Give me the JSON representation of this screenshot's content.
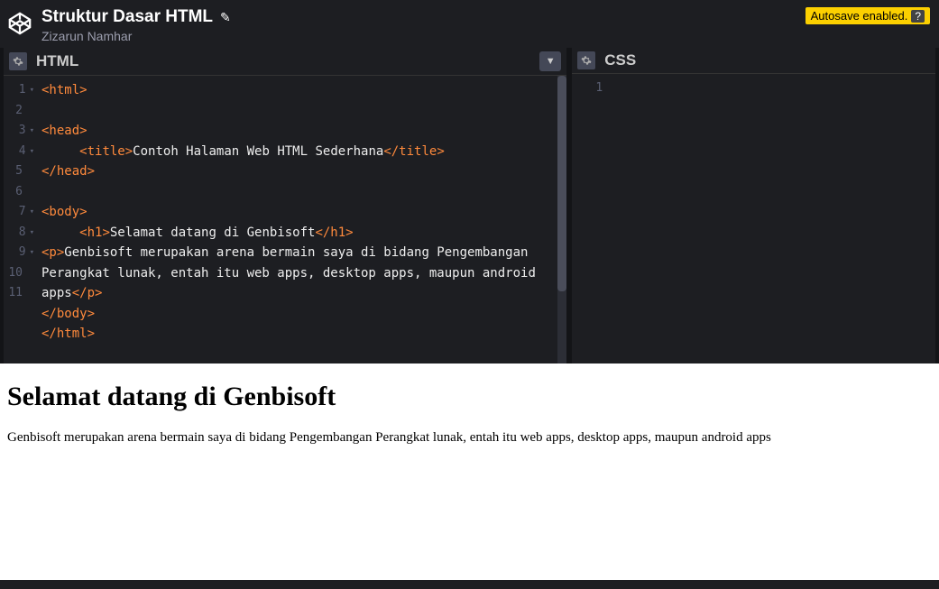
{
  "header": {
    "title": "Struktur Dasar HTML",
    "author": "Zizarun Namhar",
    "autosave": "Autosave enabled.",
    "autosave_help": "?"
  },
  "html_panel": {
    "title": "HTML",
    "lines": [
      "1",
      "2",
      "3",
      "4",
      "5",
      "6",
      "7",
      "8",
      "9",
      "",
      "10",
      "11"
    ],
    "code": [
      {
        "indent": 0,
        "tokens": [
          {
            "t": "tag",
            "v": "<html>"
          }
        ]
      },
      {
        "indent": 0,
        "tokens": []
      },
      {
        "indent": 0,
        "tokens": [
          {
            "t": "tag",
            "v": "<head>"
          }
        ]
      },
      {
        "indent": 1,
        "tokens": [
          {
            "t": "tag",
            "v": "<title>"
          },
          {
            "t": "text",
            "v": "Contoh Halaman Web HTML Sederhana"
          },
          {
            "t": "tag",
            "v": "</title>"
          }
        ]
      },
      {
        "indent": 0,
        "tokens": [
          {
            "t": "tag",
            "v": "</head>"
          }
        ]
      },
      {
        "indent": 0,
        "tokens": []
      },
      {
        "indent": 0,
        "tokens": [
          {
            "t": "tag",
            "v": "<body>"
          }
        ]
      },
      {
        "indent": 1,
        "tokens": [
          {
            "t": "tag",
            "v": "<h1>"
          },
          {
            "t": "text",
            "v": "Selamat datang di Genbisoft"
          },
          {
            "t": "tag",
            "v": "</h1>"
          }
        ]
      },
      {
        "indent": 0,
        "tokens": [
          {
            "t": "tag",
            "v": "<p>"
          },
          {
            "t": "text",
            "v": "Genbisoft merupakan arena bermain saya di bidang Pengembangan Perangkat lunak, entah itu web apps, desktop apps, maupun android apps"
          },
          {
            "t": "tag",
            "v": "</p>"
          }
        ]
      },
      {
        "indent": 0,
        "tokens": [
          {
            "t": "tag",
            "v": "</body>"
          }
        ]
      },
      {
        "indent": 0,
        "tokens": [
          {
            "t": "tag",
            "v": "</html>"
          }
        ]
      }
    ]
  },
  "css_panel": {
    "title": "CSS",
    "lines": [
      "1"
    ]
  },
  "preview": {
    "heading": "Selamat datang di Genbisoft",
    "paragraph": "Genbisoft merupakan arena bermain saya di bidang Pengembangan Perangkat lunak, entah itu web apps, desktop apps, maupun android apps"
  }
}
